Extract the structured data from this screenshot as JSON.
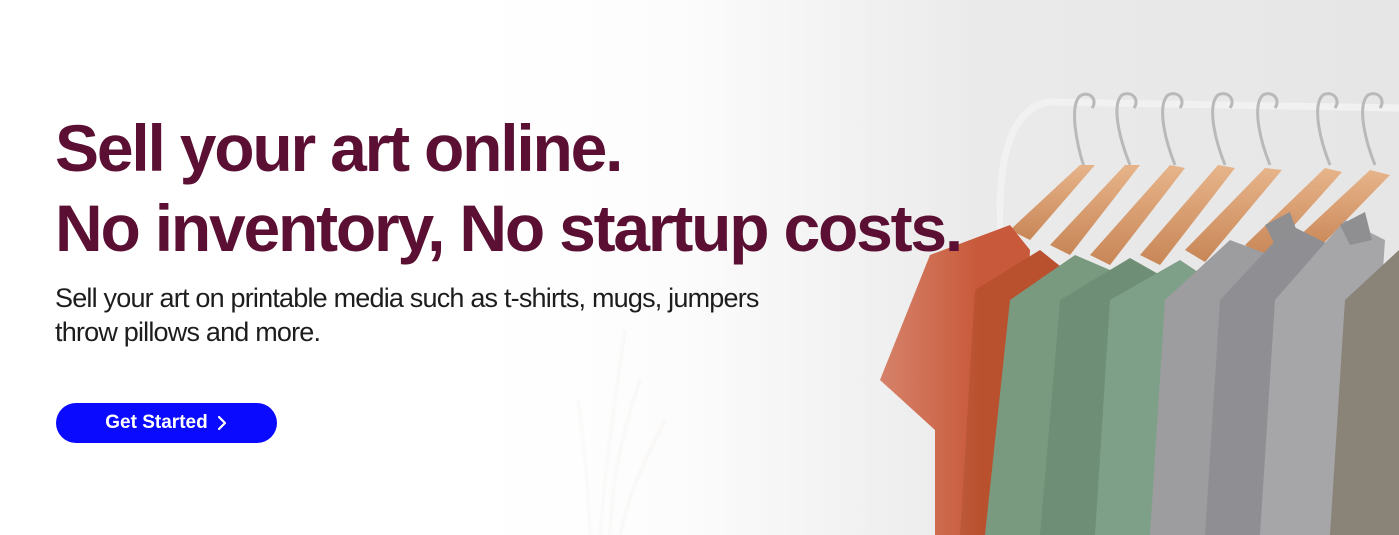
{
  "hero": {
    "headline_line1": "Sell your art online.",
    "headline_line2": "No inventory, No startup costs.",
    "subhead_line1": "Sell your art on printable media such as t-shirts, mugs, jumpers",
    "subhead_line2": "throw pillows and more.",
    "cta_label": "Get Started",
    "cta_icon": "chevron-right-icon",
    "image": "clothing-rack-with-shirts-on-hangers"
  },
  "colors": {
    "headline": "#5a0f33",
    "cta_background": "#0a0aff",
    "cta_text": "#ffffff"
  }
}
